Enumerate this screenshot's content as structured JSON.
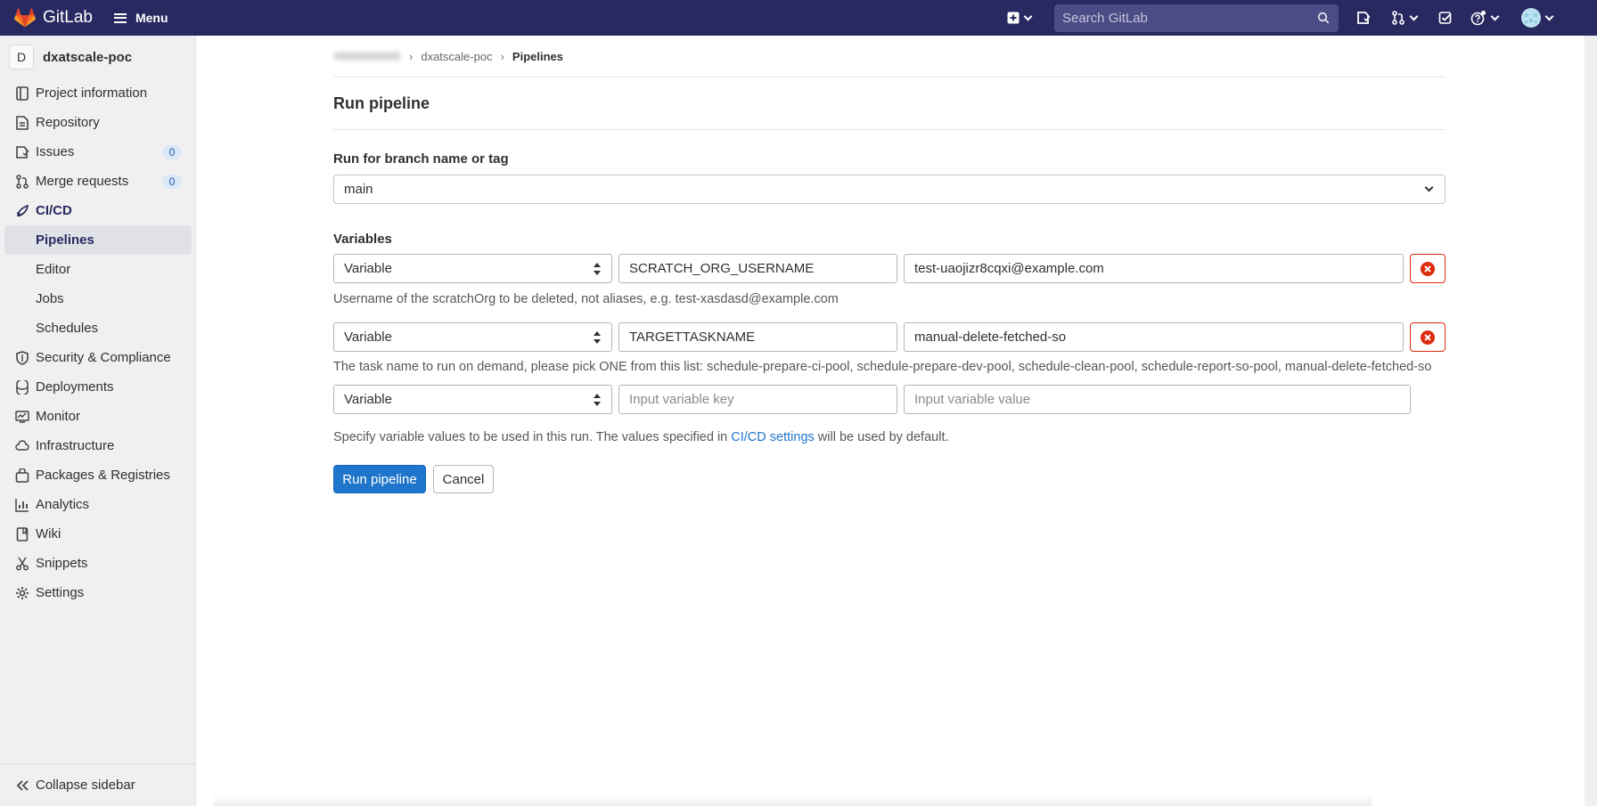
{
  "topbar": {
    "brand": "GitLab",
    "menu_label": "Menu",
    "search_placeholder": "Search GitLab"
  },
  "sidebar": {
    "project_initial": "D",
    "project_name": "dxatscale-poc",
    "items": [
      {
        "label": "Project information",
        "icon": "project-info-icon"
      },
      {
        "label": "Repository",
        "icon": "repository-icon"
      },
      {
        "label": "Issues",
        "icon": "issues-icon",
        "badge": "0"
      },
      {
        "label": "Merge requests",
        "icon": "merge-request-icon",
        "badge": "0"
      },
      {
        "label": "CI/CD",
        "icon": "rocket-icon"
      },
      {
        "label": "Pipelines"
      },
      {
        "label": "Editor"
      },
      {
        "label": "Jobs"
      },
      {
        "label": "Schedules"
      },
      {
        "label": "Security & Compliance",
        "icon": "shield-icon"
      },
      {
        "label": "Deployments",
        "icon": "deployments-icon"
      },
      {
        "label": "Monitor",
        "icon": "monitor-icon"
      },
      {
        "label": "Infrastructure",
        "icon": "infrastructure-icon"
      },
      {
        "label": "Packages & Registries",
        "icon": "package-icon"
      },
      {
        "label": "Analytics",
        "icon": "analytics-icon"
      },
      {
        "label": "Wiki",
        "icon": "wiki-icon"
      },
      {
        "label": "Snippets",
        "icon": "snippets-icon"
      },
      {
        "label": "Settings",
        "icon": "gear-icon"
      }
    ],
    "collapse_label": "Collapse sidebar"
  },
  "breadcrumb": {
    "project": "dxatscale-poc",
    "current": "Pipelines"
  },
  "page": {
    "title": "Run pipeline",
    "branch_label": "Run for branch name or tag",
    "branch_value": "main",
    "variables_label": "Variables",
    "variables": [
      {
        "type": "Variable",
        "key": "SCRATCH_ORG_USERNAME",
        "value": "test-uaojizr8cqxi@example.com",
        "help": "Username of the scratchOrg to be deleted, not aliases, e.g. test-xasdasd@example.com"
      },
      {
        "type": "Variable",
        "key": "TARGETTASKNAME",
        "value": "manual-delete-fetched-so",
        "help": "The task name to run on demand, please pick ONE from this list: schedule-prepare-ci-pool, schedule-prepare-dev-pool, schedule-clean-pool, schedule-report-so-pool, manual-delete-fetched-so"
      }
    ],
    "new_variable": {
      "type": "Variable",
      "key_placeholder": "Input variable key",
      "value_placeholder": "Input variable value"
    },
    "settings_help_prefix": "Specify variable values to be used in this run. The values specified in",
    "settings_link": "CI/CD settings",
    "settings_help_suffix": "will be used by default.",
    "run_button": "Run pipeline",
    "cancel_button": "Cancel"
  },
  "colors": {
    "topbar": "#292961",
    "primary": "#1f75cb",
    "danger": "#dd2b0e"
  }
}
